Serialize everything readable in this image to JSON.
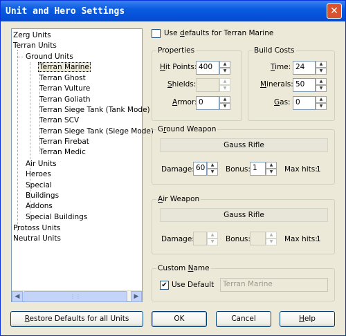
{
  "window": {
    "title": "Unit and Hero Settings"
  },
  "tree": {
    "items": [
      {
        "label": "Zerg Units"
      },
      {
        "label": "Terran Units"
      },
      {
        "label": "Ground Units"
      },
      {
        "label": "Terran Marine"
      },
      {
        "label": "Terran Ghost"
      },
      {
        "label": "Terran Vulture"
      },
      {
        "label": "Terran Goliath"
      },
      {
        "label": "Terran Siege Tank (Tank Mode)"
      },
      {
        "label": "Terran SCV"
      },
      {
        "label": "Terran Siege Tank (Siege Mode)"
      },
      {
        "label": "Terran Firebat"
      },
      {
        "label": "Terran Medic"
      },
      {
        "label": "Air Units"
      },
      {
        "label": "Heroes"
      },
      {
        "label": "Special"
      },
      {
        "label": "Buildings"
      },
      {
        "label": "Addons"
      },
      {
        "label": "Special Buildings"
      },
      {
        "label": "Protoss Units"
      },
      {
        "label": "Neutral Units"
      }
    ],
    "selected": "Terran Marine"
  },
  "defaults_checkbox": {
    "label_pre": "Use ",
    "label_ul": "d",
    "label_post": "efaults for Terran Marine",
    "checked": false
  },
  "properties": {
    "title": "Properties",
    "hit_points": {
      "label_ul": "H",
      "label_post": "it Points:",
      "value": "400"
    },
    "shields": {
      "label_ul": "S",
      "label_post": "hields:",
      "value": ""
    },
    "armor": {
      "label_ul": "A",
      "label_post": "rmor:",
      "value": "0"
    }
  },
  "build_costs": {
    "title": "Build Costs",
    "time": {
      "label_ul": "T",
      "label_post": "ime:",
      "value": "24"
    },
    "minerals": {
      "label_ul": "M",
      "label_post": "inerals:",
      "value": "50"
    },
    "gas": {
      "label_ul": "G",
      "label_post": "as:",
      "value": "0"
    }
  },
  "ground_weapon": {
    "title_pre": "G",
    "title_ul": "r",
    "title_post": "ound Weapon",
    "name": "Gauss Rifle",
    "damage_label": "Damage:",
    "damage": "60",
    "bonus_label": "Bonus:",
    "bonus": "1",
    "max_hits_label": "Max hits:",
    "max_hits": "1"
  },
  "air_weapon": {
    "title_pre": "",
    "title_ul": "A",
    "title_post": "ir Weapon",
    "name": "Gauss Rifle",
    "damage_label": "Damage:",
    "damage": "",
    "bonus_label": "Bonus:",
    "bonus": "",
    "max_hits_label": "Max hits:",
    "max_hits": "1"
  },
  "custom_name": {
    "title_pre": "Custom ",
    "title_ul": "N",
    "title_post": "ame",
    "use_default_label": "Use Default",
    "use_default_checked": true,
    "value": "Terran Marine"
  },
  "buttons": {
    "restore_ul": "R",
    "restore_post": "estore Defaults for all Units",
    "ok": "OK",
    "cancel": "Cancel",
    "help_ul": "H",
    "help_post": "elp"
  }
}
